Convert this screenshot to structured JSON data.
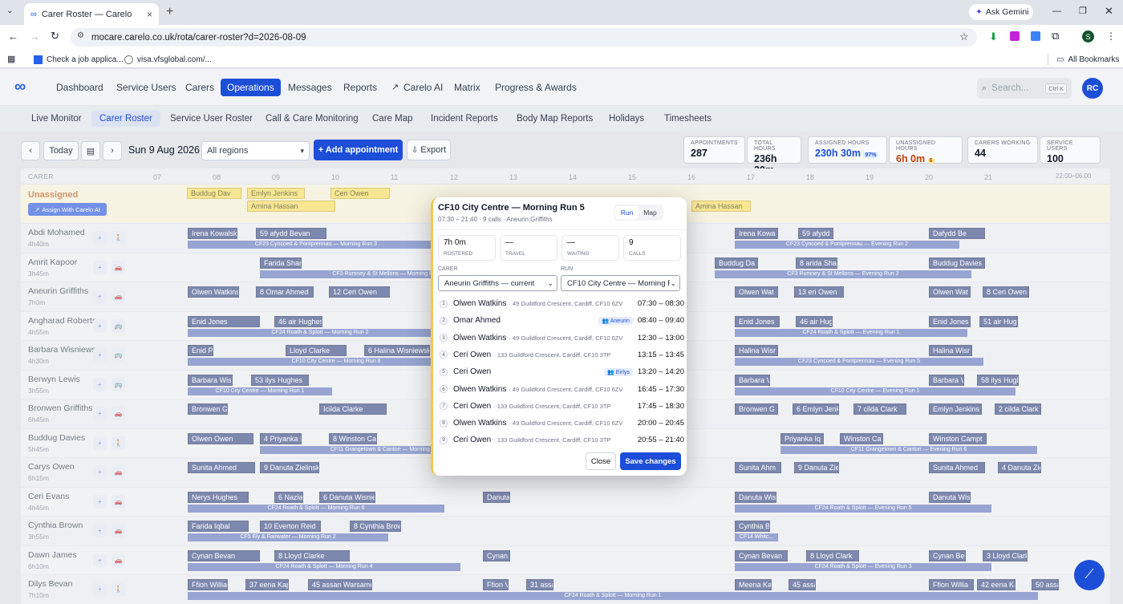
{
  "browser": {
    "tab_title": "Carer Roster — Carelo",
    "url": "mocare.carelo.co.uk/rota/carer-roster?d=2026-08-09",
    "ask": "Ask Gemini",
    "bookmarks": [
      "Check a job applica...",
      "visa.vfsglobal.com/..."
    ],
    "all_bookmarks": "All Bookmarks",
    "profile": "S"
  },
  "nav": {
    "items": [
      "Dashboard",
      "Service Users",
      "Carers",
      "Operations",
      "Messages",
      "Reports",
      "Carelo AI",
      "Matrix",
      "Progress & Awards"
    ],
    "active": "Operations",
    "search_placeholder": "Search...",
    "search_kbd": "Ctrl K",
    "avatar": "RC"
  },
  "subnav": {
    "items": [
      "Live Monitor",
      "Carer Roster",
      "Service User Roster",
      "Call & Care Monitoring",
      "Care Map",
      "Incident Reports",
      "Body Map Reports",
      "Holidays",
      "Timesheets"
    ],
    "active": "Carer Roster"
  },
  "toolbar": {
    "today": "Today",
    "date": "Sun 9 Aug 2026",
    "region": "All regions",
    "add": "+ Add appointment",
    "export": "Export"
  },
  "stats": [
    {
      "label": "APPOINTMENTS",
      "value": "287"
    },
    {
      "label": "TOTAL HOURS",
      "value": "236h 30m"
    },
    {
      "label": "ASSIGNED HOURS",
      "value": "230h 30m",
      "badge": "97%"
    },
    {
      "label": "UNASSIGNED HOURS",
      "value": "6h 0m",
      "badge": "6"
    },
    {
      "label": "CARERS WORKING",
      "value": "44"
    },
    {
      "label": "SERVICE USERS",
      "value": "100"
    }
  ],
  "grid": {
    "carer_col": "CARER",
    "hours": [
      "07",
      "08",
      "09",
      "10",
      "11",
      "12",
      "13",
      "14",
      "15",
      "16",
      "17",
      "18",
      "19",
      "20",
      "21",
      "22:00–06:00"
    ],
    "unassigned_label": "Unassigned",
    "assign_ai": "Assign With Carelo AI",
    "unassigned_blocks": [
      "Buddug Dav",
      "Emlyn Jenkins",
      "Ceri Owen",
      "Amina Hassan",
      "Amina Hassan"
    ],
    "rows": [
      {
        "name": "Abdi Mohamed",
        "hours": "4h40m",
        "icon": "walk",
        "blocks": [
          "Irena Kowalski",
          "59 afydd Bevan",
          "Irena Kowa",
          "59 afydd",
          "Dafydd Be"
        ],
        "runs": [
          "CF23 Cyncoed & Pontprennau — Morning Run 3",
          "CF23 Cyncoed & Pontprennau — Evening Run 2"
        ]
      },
      {
        "name": "Amrit Kapoor",
        "hours": "3h45m",
        "icon": "car",
        "blocks": [
          "Farida Shar",
          "Buddug Da",
          "8 arida Shar",
          "Buddug Davies"
        ],
        "runs": [
          "CF3 Rumney & St Mellons — Morning Run 3",
          "CF3 Rumney & St Mellons — Evening Run 2"
        ]
      },
      {
        "name": "Aneurin Griffiths",
        "hours": "7h0m",
        "icon": "car",
        "blocks": [
          "Olwen Watkins",
          "8 Omar Ahmed",
          "12 Ceri Owen",
          "Olwen Wat",
          "13 eri Owen",
          "Olwen Wat",
          "8 Ceri Owen"
        ],
        "runs": []
      },
      {
        "name": "Angharad Roberts",
        "hours": "4h55m",
        "icon": "bus",
        "blocks": [
          "Enid Jones",
          "46 air Hughes",
          "Enid Jones",
          "46 air Hugh",
          "Enid Jones",
          "51 air Hug"
        ],
        "runs": [
          "CF24 Roath & Splott — Morning Run 2",
          "CF24 Roath & Splott — Evening Run 1"
        ]
      },
      {
        "name": "Barbara Wisniewsk",
        "hours": "4h30m",
        "icon": "bus",
        "blocks": [
          "Enid P",
          "Lloyd Clarke",
          "6 Halina Wisniewska",
          "Halina Wisr",
          "Halina Wisr"
        ],
        "runs": [
          "CF10 City Centre — Morning Run 8",
          "CF23 Cyncoed & Pontprennau — Evening Run 5"
        ]
      },
      {
        "name": "Berwyn Lewis",
        "hours": "3h55m",
        "icon": "bus",
        "blocks": [
          "Barbara Wisi",
          "53 ilys Hughes",
          "Barbara V",
          "Barbara V",
          "58 ilys Hughe"
        ],
        "runs": [
          "CF10 City Centre — Morning Run 1",
          "CF10 City Centre — Evening Run 1"
        ]
      },
      {
        "name": "Bronwen Griffiths",
        "hours": "6h45m",
        "icon": "car",
        "blocks": [
          "Bronwen G",
          "Icilda Clarke",
          "Bronwen G",
          "6 Emlyn Jenk",
          "7 cilda Clark",
          "Emlyn Jenkins",
          "2 cilda Clark"
        ],
        "runs": []
      },
      {
        "name": "Buddug Davies",
        "hours": "5h45m",
        "icon": "walk",
        "blocks": [
          "Olwen Owen",
          "4 Priyanka Iq",
          "8 Winston Can",
          "Priyanka Iq",
          "Winston Ca",
          "Winston Campt"
        ],
        "runs": [
          "CF11 Grangetown & Canton — Morning Run 6",
          "CF11 Grangetown & Canton — Evening Run 6"
        ]
      },
      {
        "name": "Carys Owen",
        "hours": "6h15m",
        "icon": "car",
        "blocks": [
          "Sunita Ahmed",
          "9 Danuta Zielinski",
          "Sunita Ahm",
          "9 Danuta Ziel",
          "Sunita Ahmed",
          "4 Danuta Ziel"
        ],
        "runs": []
      },
      {
        "name": "Ceri Evans",
        "hours": "4h45m",
        "icon": "car",
        "blocks": [
          "Nerys Hughes",
          "6 Nazia I",
          "6 Danuta Wisniew",
          "Danuta",
          "Danuta Wis",
          "Danuta Wis"
        ],
        "runs": [
          "CF24 Roath & Splott — Morning Run 6",
          "CF24 Roath & Splott — Evening Run 5"
        ]
      },
      {
        "name": "Cynthia Brown",
        "hours": "3h55m",
        "icon": "car",
        "blocks": [
          "Farida Iqbal",
          "10 Everton Reid",
          "8 Cynthia Browr",
          "Cynthia Brc"
        ],
        "runs": [
          "CF5 Ely & Fairwater — Morning Run 2",
          "CF14 Whitc..."
        ]
      },
      {
        "name": "Dawn James",
        "hours": "6h10m",
        "icon": "car",
        "blocks": [
          "Cynan Bevan",
          "8 Lloyd Clarke",
          "Cynan",
          "Cynan Bevan",
          "8 Lloyd Clark",
          "Cynan Be",
          "3 Lloyd Clark"
        ],
        "runs": [
          "CF24 Roath & Splott — Morning Run 4",
          "CF24 Roath & Splott — Evening Run 3"
        ]
      },
      {
        "name": "Dilys Bevan",
        "hours": "7h10m",
        "icon": "walk",
        "blocks": [
          "Ffion Willia",
          "37 eena Kapo",
          "45 assan Warsame",
          "Ffion V",
          "31 assa",
          "Meena Ka",
          "45 assa",
          "Ffion Willia",
          "42 eena Ka",
          "50 assa"
        ],
        "runs": [
          "CF24 Roath & Splott — Morning Run 1"
        ]
      }
    ]
  },
  "modal": {
    "title": "CF10 City Centre — Morning Run 5",
    "subtitle": "07:30 – 21:40 · 9 calls · Aneurin Griffiths",
    "tab_run": "Run",
    "tab_map": "Map",
    "metrics": [
      {
        "value": "7h 0m",
        "label": "ROSTERED"
      },
      {
        "value": "—",
        "label": "TRAVEL"
      },
      {
        "value": "—",
        "label": "WAITING"
      },
      {
        "value": "9",
        "label": "CALLS"
      }
    ],
    "carer_label": "CARER",
    "carer_value": "Aneurin Griffiths — current",
    "run_label": "RUN",
    "run_value": "CF10 City Centre — Morning Run 5",
    "calls": [
      {
        "n": "1",
        "name": "Olwen Watkins",
        "addr": "· 49 Guildford Crescent, Cardiff, CF10 6ZV",
        "tag": "",
        "time": "07:30 – 08:30"
      },
      {
        "n": "2",
        "name": "Omar Ahmed",
        "addr": "",
        "tag": "Aneurin",
        "time": "08:40 – 09:40"
      },
      {
        "n": "3",
        "name": "Olwen Watkins",
        "addr": "· 49 Guildford Crescent, Cardiff, CF10 6ZV",
        "tag": "",
        "time": "12:30 – 13:00"
      },
      {
        "n": "4",
        "name": "Ceri Owen",
        "addr": "· 133 Guildford Crescent, Cardiff, CF10 3TP",
        "tag": "",
        "time": "13:15 – 13:45"
      },
      {
        "n": "5",
        "name": "Ceri Owen",
        "addr": "",
        "tag": "Eirlys",
        "time": "13:20 – 14:20"
      },
      {
        "n": "6",
        "name": "Olwen Watkins",
        "addr": "· 49 Guildford Crescent, Cardiff, CF10 6ZV",
        "tag": "",
        "time": "16:45 – 17:30"
      },
      {
        "n": "7",
        "name": "Ceri Owen",
        "addr": "· 133 Guildford Crescent, Cardiff, CF10 3TP",
        "tag": "",
        "time": "17:45 – 18:30"
      },
      {
        "n": "8",
        "name": "Olwen Watkins",
        "addr": "· 49 Guildford Crescent, Cardiff, CF10 6ZV",
        "tag": "",
        "time": "20:00 – 20:45"
      },
      {
        "n": "9",
        "name": "Ceri Owen",
        "addr": "· 133 Guildford Crescent, Cardiff, CF10 3TP",
        "tag": "",
        "time": "20:55 – 21:40"
      }
    ],
    "close": "Close",
    "save": "Save changes"
  }
}
